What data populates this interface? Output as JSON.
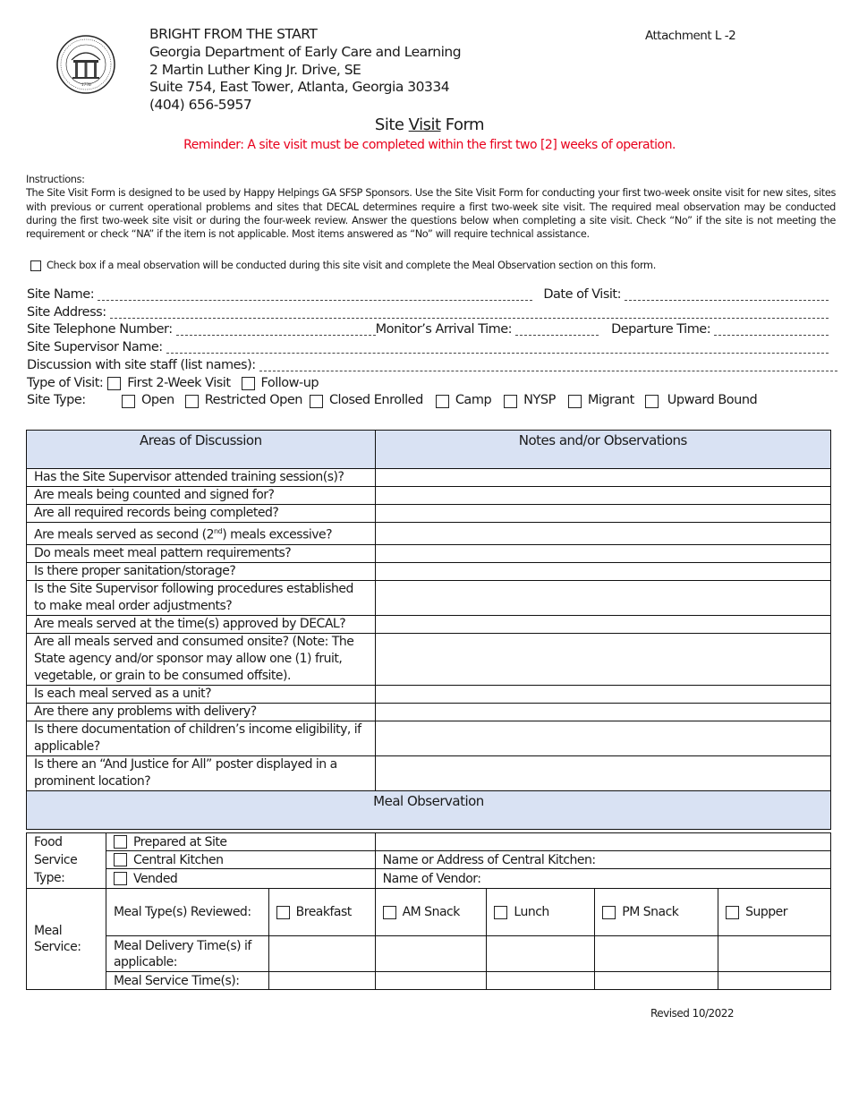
{
  "header": {
    "seal_icon": "state-of-georgia-seal",
    "org_lines": [
      "BRIGHT FROM THE START",
      "Georgia Department of Early Care and Learning",
      "2 Martin Luther King Jr. Drive, SE",
      "Suite 754, East Tower, Atlanta, Georgia 30334",
      "(404) 656-5957"
    ],
    "attachment": "Attachment L -2"
  },
  "title": {
    "pre": "Site ",
    "underlined": "Visit",
    "post": " Form"
  },
  "reminder": "Reminder: A site visit must be completed within the first two [2] weeks of operation.",
  "instructions": {
    "label": "Instructions:",
    "text": "The Site Visit Form is designed to be used by Happy Helpings GA SFSP Sponsors. Use the Site Visit Form for conducting your first two-week onsite visit for new sites, sites with previous or current operational problems and sites that DECAL determines require a first two-week site visit. The required meal observation may be conducted during the first two-week site visit or during the four-week review. Answer the questions below when completing a site visit. Check “No” if the site is not meeting the requirement or check “NA” if the item is not applicable. Most items answered as “No” will require technical assistance."
  },
  "meal_observation_checkbox": {
    "label": "Check box if a meal observation will be conducted during this site visit and complete the Meal Observation section on this form.",
    "checked": false
  },
  "fields": {
    "site_name": "Site Name:",
    "date_of_visit": "Date of Visit:",
    "site_address": "Site Address:",
    "site_telephone": "Site Telephone Number:",
    "arrival_time": "Monitor’s Arrival Time:",
    "departure_time": "Departure Time:",
    "supervisor_name": "Site Supervisor Name:",
    "discussion": "Discussion with site staff (list names):",
    "type_of_visit": {
      "label": "Type of Visit:",
      "options": [
        "First 2-Week Visit",
        "Follow-up"
      ]
    },
    "site_type": {
      "label": "Site Type:",
      "options": [
        "Open",
        "Restricted Open",
        "Closed Enrolled",
        "Camp",
        "NYSP",
        "Migrant",
        "Upward Bound"
      ]
    }
  },
  "table": {
    "col_headers": [
      "Areas of Discussion",
      "Notes and/or Observations"
    ],
    "rows": [
      "Has the Site Supervisor attended training session(s)?",
      "Are meals being counted and signed for?",
      "Are all required records being completed?",
      "Are meals served as second (2nd) meals excessive?",
      "Do meals meet meal pattern requirements?",
      "Is there proper sanitation/storage?",
      "Is the Site Supervisor following procedures established to make meal order adjustments?",
      "Are meals served at the time(s) approved by DECAL?",
      "Are all meals served and consumed onsite? (Note: The State agency and/or sponsor may allow one (1) fruit, vegetable, or grain to be consumed offsite).",
      "Is each meal served as a unit?",
      "Are there any problems with delivery?",
      "Is there documentation of children’s income eligibility, if applicable?",
      "Is there an “And Justice for All” poster displayed in a prominent location?"
    ],
    "row3_parts": {
      "pre": "Are meals served as second (2",
      "sup": "nd",
      "post": ") meals excessive?"
    },
    "meal_observation_header": "Meal Observation",
    "food_service": {
      "label": "Food Service Type:",
      "options": [
        "Prepared at Site",
        "Central Kitchen",
        "Vended"
      ],
      "central_kitchen_label": "Name or Address of Central Kitchen:",
      "vendor_label": "Name of Vendor:"
    },
    "meal_service": {
      "label": "Meal Service:",
      "types_label": "Meal Type(s) Reviewed:",
      "types": [
        "Breakfast",
        "AM Snack",
        "Lunch",
        "PM Snack",
        "Supper"
      ],
      "delivery_label": "Meal Delivery Time(s) if applicable:",
      "service_time_label": "Meal Service Time(s):"
    }
  },
  "footer": {
    "revised": "Revised 10/2022"
  },
  "colors": {
    "reminder": "#e8001c",
    "header_fill": "#d9e2f3"
  }
}
